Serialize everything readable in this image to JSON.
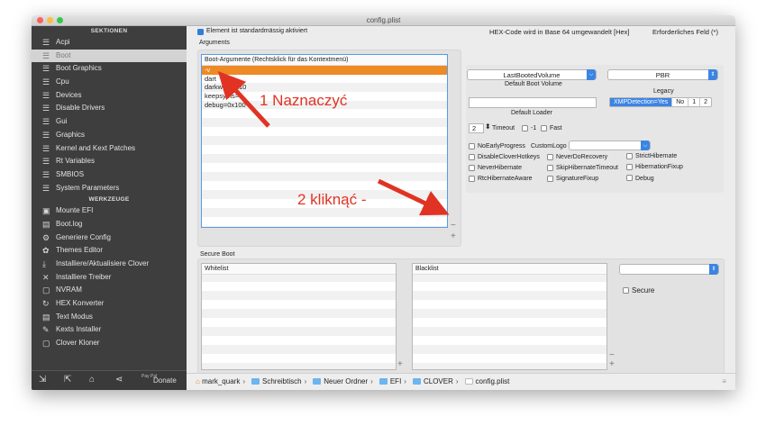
{
  "window": {
    "title": "config.plist"
  },
  "sidebar": {
    "section1": "SEKTIONEN",
    "sections": [
      "Acpi",
      "Boot",
      "Boot Graphics",
      "Cpu",
      "Devices",
      "Disable Drivers",
      "Gui",
      "Graphics",
      "Kernel and Kext Patches",
      "Rt Variables",
      "SMBIOS",
      "System Parameters"
    ],
    "section2": "WERKZEUGE",
    "tools": [
      "Mounte EFI",
      "Boot.log",
      "Generiere Config",
      "Themes Editor",
      "Installiere/Aktualisiere Clover",
      "Installiere Treiber",
      "NVRAM",
      "HEX Konverter",
      "Text Modus",
      "Kexts Installer",
      "Clover Kloner"
    ],
    "donate": "Donate",
    "donate_small": "Pay Pal"
  },
  "topbar": {
    "element_default": "Element ist standardmässig aktiviert",
    "hex_note": "HEX-Code wird in Base 64 umgewandelt [Hex]",
    "required": "Erforderliches Feld (*)"
  },
  "arguments": {
    "label": "Arguments",
    "header": "Boot-Argumente (Rechtsklick für das Kontextmenü)",
    "rows": [
      "-v",
      "dart=0",
      "darkwake=10",
      "keepsyms=1",
      "debug=0x100"
    ],
    "rows_visible": [
      "-v",
      "dart",
      "darkw",
      "keepsyms=",
      "debug=0x100"
    ],
    "row3_suffix": "10",
    "minus": "−",
    "plus": "+"
  },
  "boot": {
    "default_volume": "LastBootedVolume",
    "default_volume_label": "Default Boot Volume",
    "legacy": "PBR",
    "legacy_label": "Legacy",
    "default_loader_label": "Default Loader",
    "default_loader_value": "",
    "xmp": [
      "XMPDetection=Yes",
      "No",
      "1",
      "2"
    ],
    "timeout_value": "2",
    "timeout_label": "Timeout",
    "minus1_label": "-1",
    "fast_label": "Fast",
    "noearly_label": "NoEarlyProgress",
    "customlogo_label": "CustomLogo",
    "checks": [
      [
        "DisableCloverHotkeys",
        "NeverDoRecovery",
        "StrictHibernate"
      ],
      [
        "NeverHibernate",
        "SkipHibernateTimeout",
        "HibernationFixup"
      ],
      [
        "RtcHibernateAware",
        "SignatureFixup",
        "Debug"
      ]
    ]
  },
  "secure_boot": {
    "label": "Secure Boot",
    "whitelist": "Whitelist",
    "blacklist": "Blacklist",
    "secure": "Secure",
    "plus": "+",
    "minus": "−"
  },
  "pathbar": {
    "user": "mark_quark",
    "items": [
      "Schreibtisch",
      "Neuer Ordner",
      "EFI",
      "CLOVER",
      "config.plist"
    ]
  },
  "annotations": {
    "step1": "1 Naznaczyć",
    "step2": "2 kliknąć -"
  },
  "colors": {
    "accent": "#3b84e4",
    "selection": "#ed8a24",
    "annotation": "#e03324",
    "sidebar": "#3e3e3e"
  }
}
